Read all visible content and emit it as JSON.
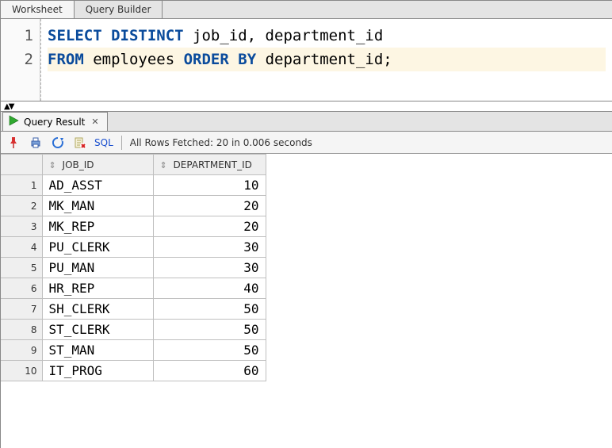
{
  "tabs": {
    "primary": [
      {
        "label": "Worksheet",
        "active": true
      },
      {
        "label": "Query Builder",
        "active": false
      }
    ],
    "result_tab_label": "Query Result"
  },
  "editor": {
    "lines": [
      {
        "num": "1",
        "tokens": [
          {
            "t": "SELECT",
            "kw": true
          },
          {
            "t": " ",
            "kw": false
          },
          {
            "t": "DISTINCT",
            "kw": true
          },
          {
            "t": " job_id, department_id",
            "kw": false
          }
        ],
        "hl": false
      },
      {
        "num": "2",
        "tokens": [
          {
            "t": "FROM",
            "kw": true
          },
          {
            "t": " employees ",
            "kw": false
          },
          {
            "t": "ORDER",
            "kw": true
          },
          {
            "t": " ",
            "kw": false
          },
          {
            "t": "BY",
            "kw": true
          },
          {
            "t": " department_id;",
            "kw": false
          }
        ],
        "hl": true
      }
    ]
  },
  "toolbar": {
    "sql_label": "SQL",
    "status": "All Rows Fetched: 20 in 0.006 seconds"
  },
  "grid": {
    "columns": [
      {
        "key": "job_id",
        "label": "JOB_ID"
      },
      {
        "key": "department_id",
        "label": "DEPARTMENT_ID"
      }
    ],
    "rows": [
      {
        "job_id": "AD_ASST",
        "department_id": "10"
      },
      {
        "job_id": "MK_MAN",
        "department_id": "20"
      },
      {
        "job_id": "MK_REP",
        "department_id": "20"
      },
      {
        "job_id": "PU_CLERK",
        "department_id": "30"
      },
      {
        "job_id": "PU_MAN",
        "department_id": "30"
      },
      {
        "job_id": "HR_REP",
        "department_id": "40"
      },
      {
        "job_id": "SH_CLERK",
        "department_id": "50"
      },
      {
        "job_id": "ST_CLERK",
        "department_id": "50"
      },
      {
        "job_id": "ST_MAN",
        "department_id": "50"
      },
      {
        "job_id": "IT_PROG",
        "department_id": "60"
      }
    ]
  }
}
